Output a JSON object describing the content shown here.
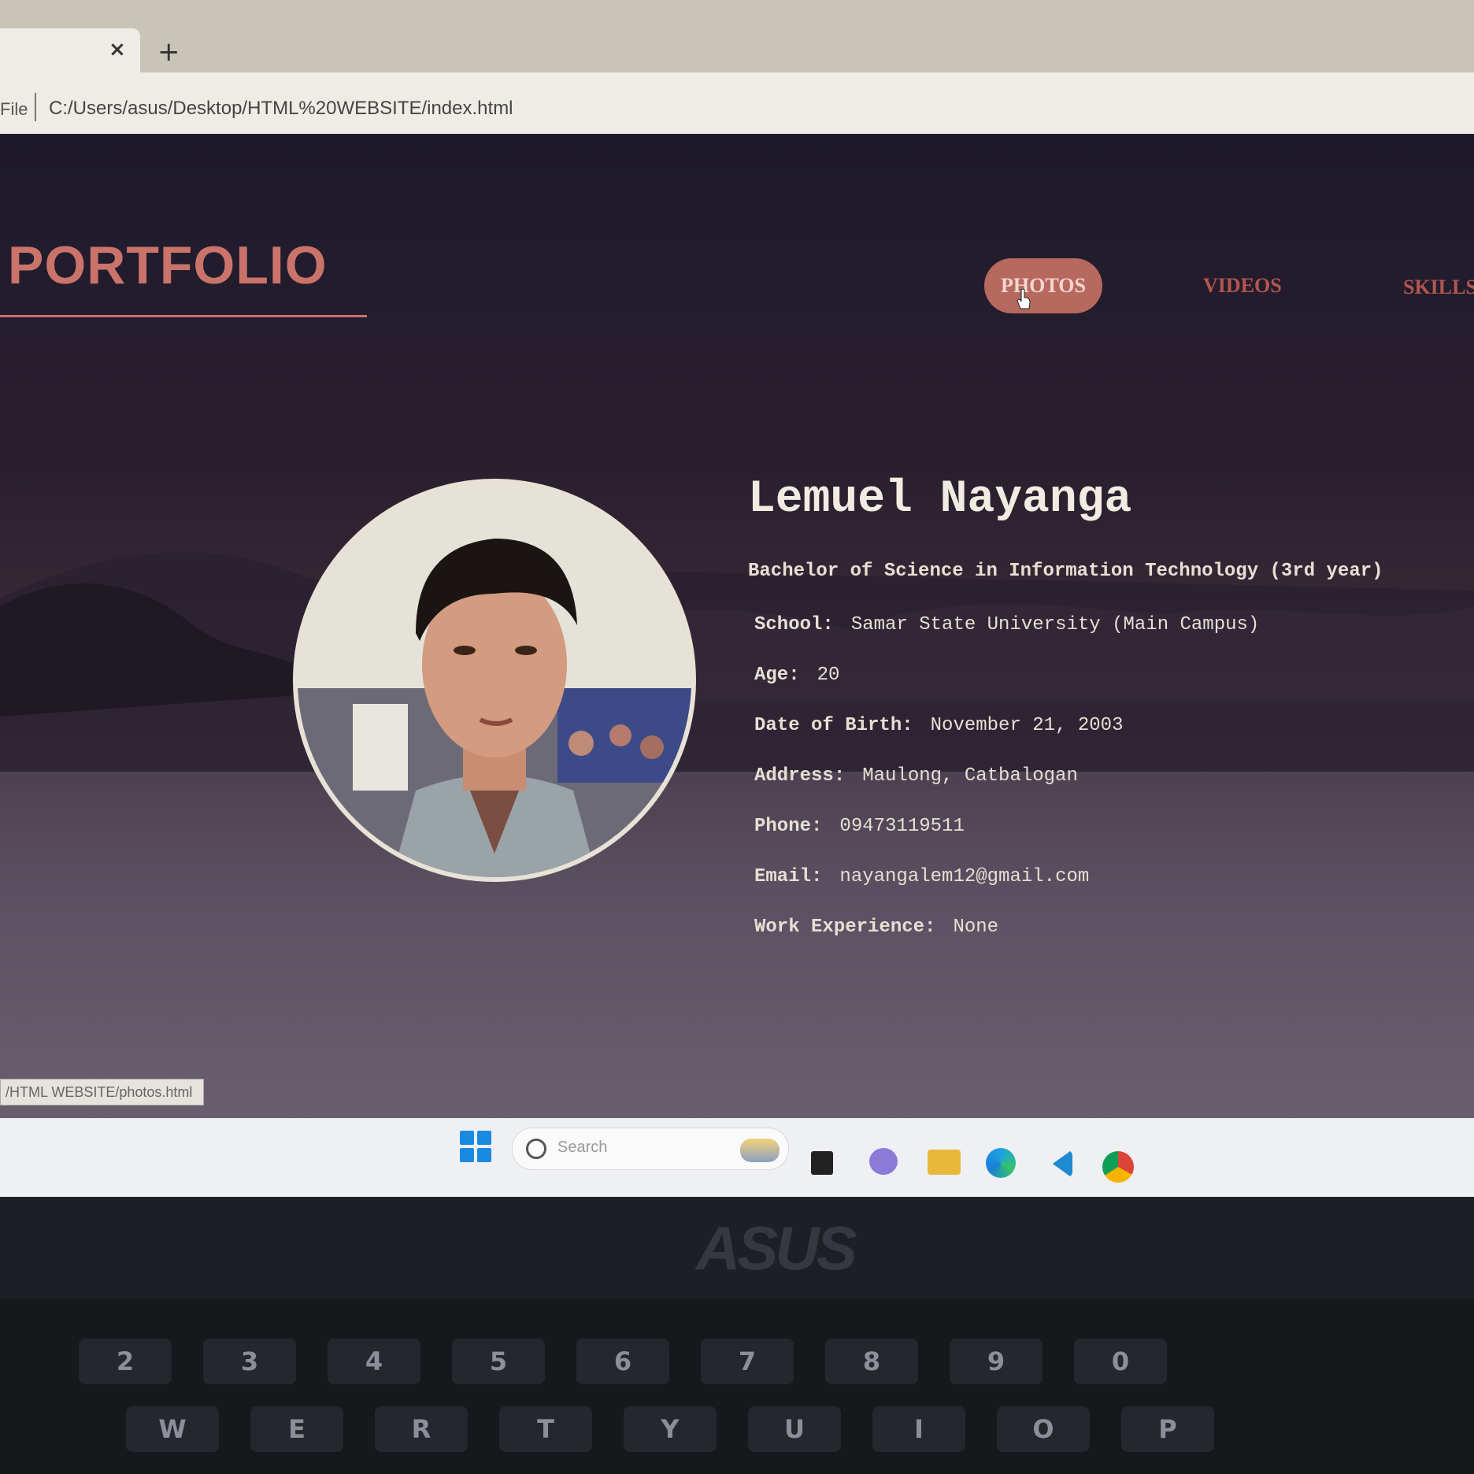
{
  "browser": {
    "new_tab": "+",
    "close_tab": "×",
    "file_label": "File",
    "url": "C:/Users/asus/Desktop/HTML%20WEBSITE/index.html",
    "status_url": "/HTML WEBSITE/photos.html"
  },
  "page": {
    "logo": "PORTFOLIO",
    "nav": [
      "PHOTOS",
      "VIDEOS",
      "SKILLS"
    ],
    "profile": {
      "name": "Lemuel Nayanga",
      "degree": "Bachelor of Science in Information Technology (3rd year)",
      "fields": [
        {
          "label": "School:",
          "value": "Samar State University (Main Campus)"
        },
        {
          "label": "Age:",
          "value": "20"
        },
        {
          "label": "Date of Birth:",
          "value": "November 21, 2003"
        },
        {
          "label": "Address:",
          "value": "Maulong, Catbalogan"
        },
        {
          "label": "Phone:",
          "value": "09473119511"
        },
        {
          "label": "Email:",
          "value": "nayangalem12@gmail.com"
        },
        {
          "label": "Work Experience:",
          "value": "None"
        }
      ]
    }
  },
  "taskbar": {
    "search_placeholder": "Search",
    "icons": [
      "windows-start-icon",
      "weather-icon",
      "file-icon",
      "chat-icon",
      "folder-icon",
      "edge-icon",
      "vscode-icon",
      "chrome-icon"
    ]
  },
  "laptop": {
    "brand": "ASUS",
    "keys_row1": [
      "2",
      "3",
      "4",
      "5",
      "6",
      "7",
      "8",
      "9",
      "0"
    ],
    "keys_row2": [
      "W",
      "E",
      "R",
      "T",
      "Y",
      "U",
      "I",
      "O",
      "P"
    ]
  }
}
